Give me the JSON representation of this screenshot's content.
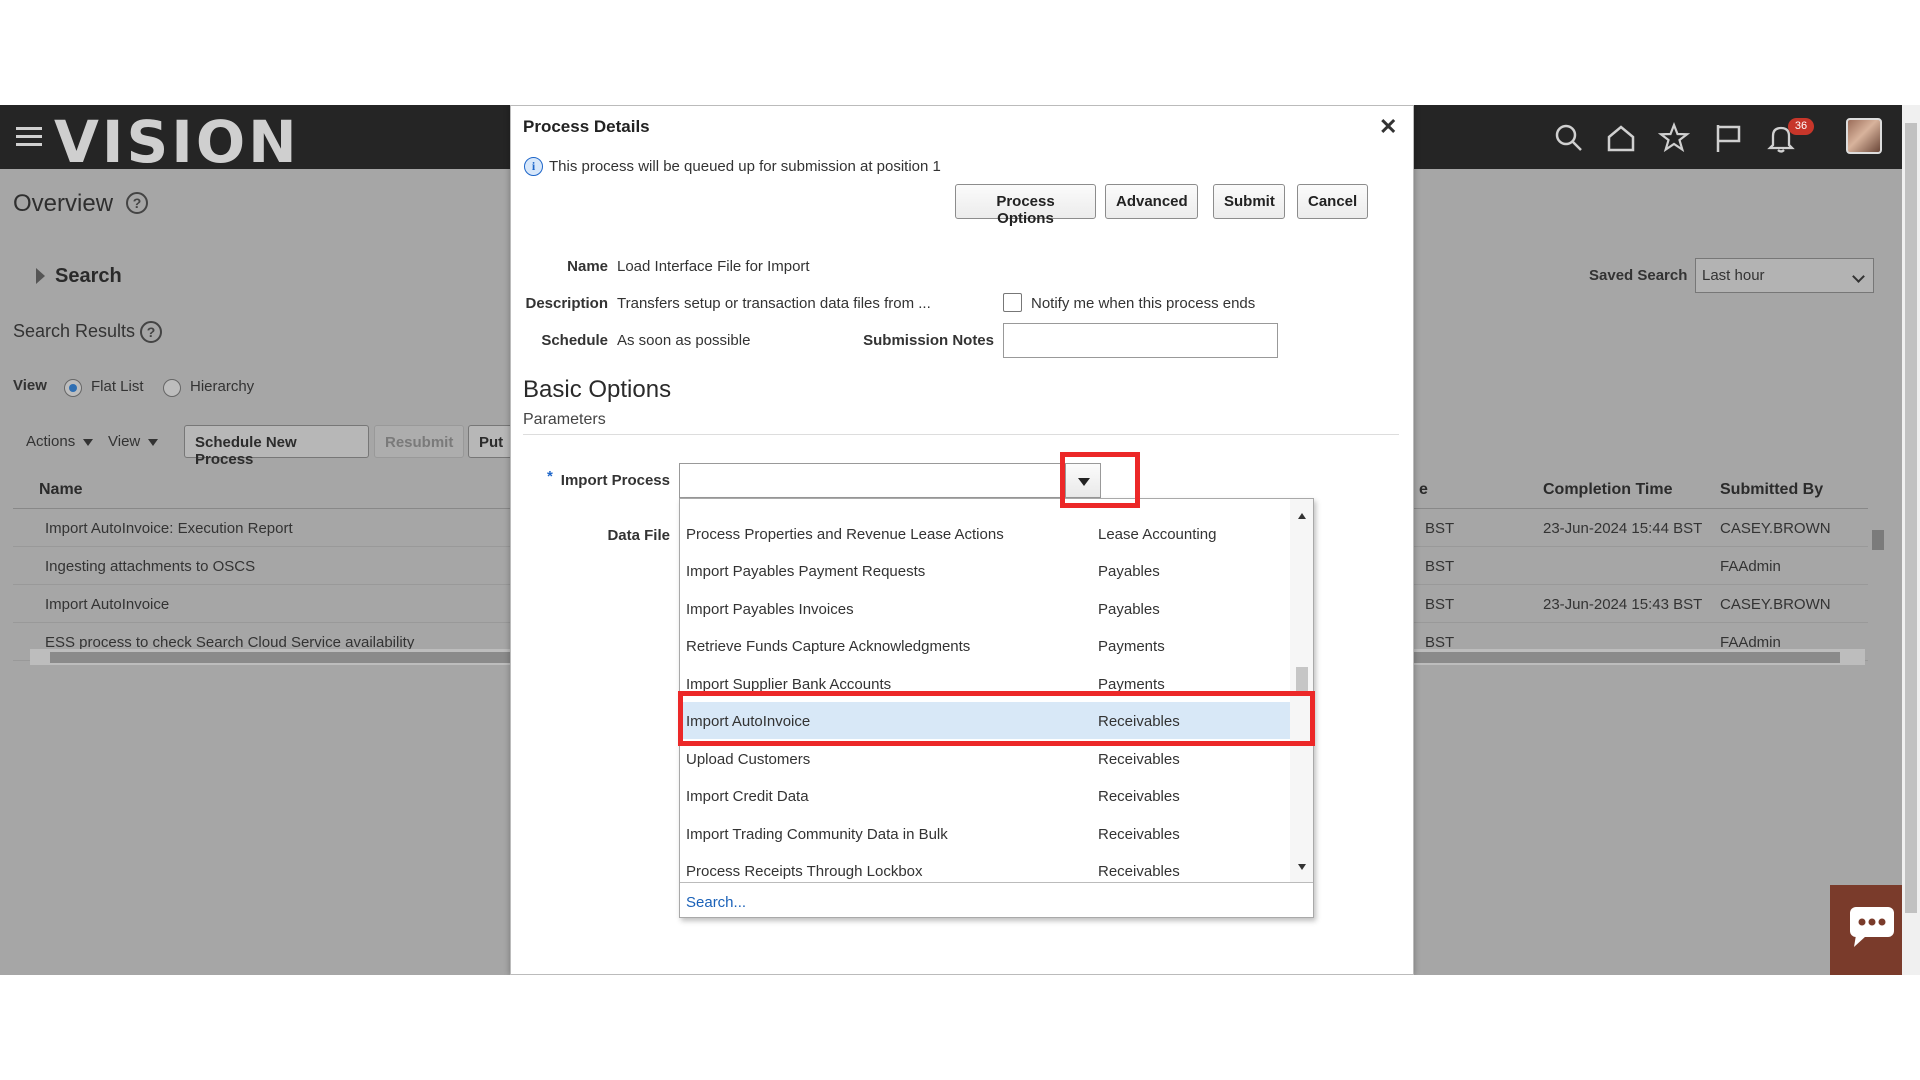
{
  "header": {
    "logo": "VISION",
    "notification_count": "36"
  },
  "page": {
    "title": "Overview",
    "search_section": "Search",
    "results_title": "Search Results",
    "view_label": "View",
    "view_options": [
      "Flat List",
      "Hierarchy"
    ],
    "saved_search_label": "Saved Search",
    "saved_search_value": "Last hour",
    "toolbar": {
      "actions": "Actions",
      "view": "View",
      "schedule": "Schedule New Process",
      "resubmit": "Resubmit",
      "put": "Put"
    },
    "table": {
      "columns": [
        "Name",
        "e",
        "Completion Time",
        "Submitted By"
      ],
      "rows": [
        {
          "name": "Import AutoInvoice: Execution Report",
          "tz": "BST",
          "completion": "23-Jun-2024 15:44 BST",
          "by": "CASEY.BROWN"
        },
        {
          "name": "Ingesting attachments to OSCS",
          "tz": "BST",
          "completion": "",
          "by": "FAAdmin"
        },
        {
          "name": "Import AutoInvoice",
          "tz": "BST",
          "completion": "23-Jun-2024 15:43 BST",
          "by": "CASEY.BROWN"
        },
        {
          "name": "ESS process to check Search Cloud Service availability",
          "tz": "BST",
          "completion": "",
          "by": "FAAdmin"
        }
      ]
    }
  },
  "dialog": {
    "title": "Process Details",
    "close": "✕",
    "info": "This process will be queued up for submission at position 1",
    "buttons": {
      "process_options": "Process Options",
      "advanced": "Advanced",
      "submit": "Submit",
      "cancel": "Cancel"
    },
    "name_label": "Name",
    "name_value": "Load Interface File for Import",
    "description_label": "Description",
    "description_value": "Transfers setup or transaction data files from ...",
    "schedule_label": "Schedule",
    "schedule_value": "As soon as possible",
    "notify_label": "Notify me when this process ends",
    "notes_label": "Submission Notes",
    "basic_options": "Basic Options",
    "parameters": "Parameters",
    "import_process_label": "Import Process",
    "data_file_label": "Data File",
    "dropdown": {
      "rows": [
        {
          "process": "Process Properties and Revenue Lease Actions",
          "area": "Lease Accounting"
        },
        {
          "process": "Import Payables Payment Requests",
          "area": "Payables"
        },
        {
          "process": "Import Payables Invoices",
          "area": "Payables"
        },
        {
          "process": "Retrieve Funds Capture Acknowledgments",
          "area": "Payments"
        },
        {
          "process": "Import Supplier Bank Accounts",
          "area": "Payments"
        },
        {
          "process": "Import AutoInvoice",
          "area": "Receivables"
        },
        {
          "process": "Upload Customers",
          "area": "Receivables"
        },
        {
          "process": "Import Credit Data",
          "area": "Receivables"
        },
        {
          "process": "Import Trading Community Data in Bulk",
          "area": "Receivables"
        },
        {
          "process": "Process Receipts Through Lockbox",
          "area": "Receivables"
        }
      ],
      "selected_index": 5,
      "search_link": "Search..."
    }
  },
  "colors": {
    "highlight_red": "#ec2828",
    "selected_row": "#d8e8f7",
    "header_bg": "#252525"
  }
}
